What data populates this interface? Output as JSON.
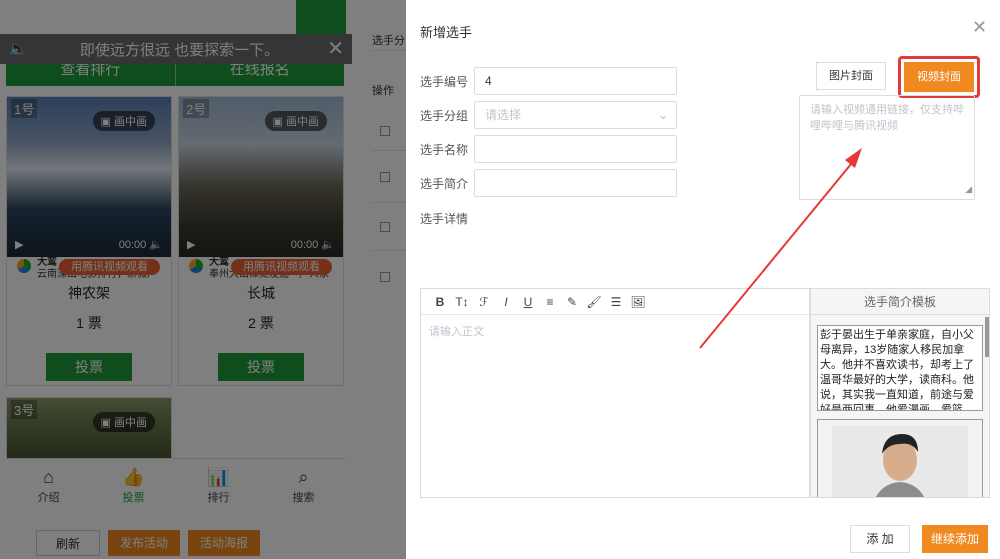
{
  "phone": {
    "marquee_text": "即使远方很远 也要探索一下。",
    "top_tabs": [
      "查看排行",
      "在线报名"
    ],
    "cards": [
      {
        "num": "1号",
        "pip": "画中画",
        "time": "00:00",
        "source_title": "大鸾",
        "source_sub": "云南深山电影排行，紫薇户",
        "tx_label": "用腾讯视频观看",
        "name": "神农架",
        "votes": "1 票",
        "vote_btn": "投票"
      },
      {
        "num": "2号",
        "pip": "画中画",
        "time": "00:00",
        "source_title": "大鸾",
        "source_sub": "奉州大山深处发掘一户人家",
        "tx_label": "用腾讯视频观看",
        "name": "长城",
        "votes": "2 票",
        "vote_btn": "投票"
      },
      {
        "num": "3号",
        "pip": "画中画"
      }
    ],
    "nav": [
      {
        "label": "介绍",
        "icon": "home-icon"
      },
      {
        "label": "投票",
        "icon": "thumb-up-icon"
      },
      {
        "label": "排行",
        "icon": "bar-chart-icon"
      },
      {
        "label": "搜索",
        "icon": "search-icon"
      }
    ]
  },
  "bottom_buttons": {
    "refresh": "刷新",
    "publish": "发布活动",
    "poster": "活动海报"
  },
  "side_list": {
    "header": "选手分",
    "ops": "操作"
  },
  "modal": {
    "title": "新增选手",
    "fields": {
      "number_label": "选手编号",
      "number_value": "4",
      "group_label": "选手分组",
      "group_placeholder": "请选择",
      "name_label": "选手名称",
      "name_value": "",
      "intro_label": "选手简介",
      "intro_value": "",
      "detail_label": "选手详情"
    },
    "cover": {
      "image_btn": "图片封面",
      "video_btn": "视频封面",
      "placeholder": "请输入视频通用链接，仅支持哔哩哔哩与腾讯视频"
    },
    "editor": {
      "tools": [
        "B",
        "T↕",
        "ℱ",
        "I",
        "U",
        "≡",
        "✎",
        "🖌",
        "☰",
        "🖼"
      ],
      "placeholder": "请输入正文"
    },
    "template": {
      "title": "选手简介模板",
      "text": "彭于晏出生于单亲家庭，自小父母离异，13岁随家人移民加拿大。他并不喜欢读书，却考上了温哥华最好的大学，读商科。他说，其实我一直知道，前途与爱好是两回事，他爱漫画，爱篮球，但在青春"
    },
    "footer": {
      "add": "添 加",
      "continue": "继续添加"
    }
  },
  "colors": {
    "green": "#1e9a3a",
    "orange": "#f08a20",
    "highlight": "#e53935"
  }
}
